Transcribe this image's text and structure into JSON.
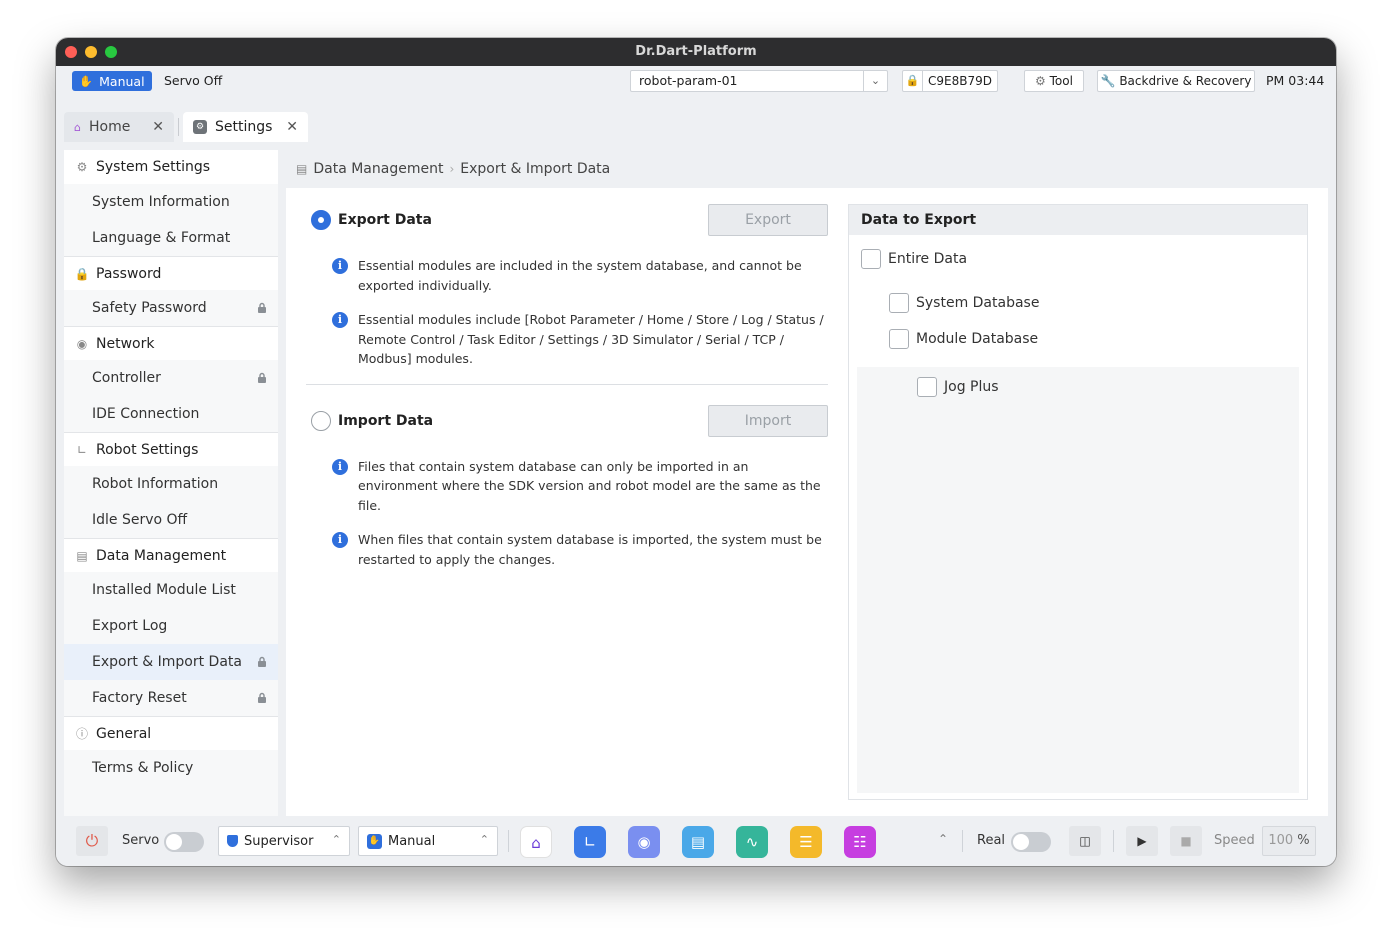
{
  "window": {
    "title": "Dr.Dart-Platform"
  },
  "topbar": {
    "mode": "Manual",
    "servo_status": "Servo Off",
    "robot_param": "robot-param-01",
    "serial": "C9E8B79D",
    "tool": "Tool",
    "backdrive": "Backdrive & Recovery",
    "clock": "PM 03:44"
  },
  "tabs": [
    {
      "label": "Home"
    },
    {
      "label": "Settings"
    }
  ],
  "sidebar": {
    "system_settings": {
      "label": "System Settings",
      "items": [
        "System Information",
        "Language & Format"
      ]
    },
    "password": {
      "label": "Password",
      "items": [
        "Safety Password"
      ]
    },
    "network": {
      "label": "Network",
      "items": [
        "Controller",
        "IDE Connection"
      ]
    },
    "robot_settings": {
      "label": "Robot Settings",
      "items": [
        "Robot Information",
        "Idle Servo Off"
      ]
    },
    "data_management": {
      "label": "Data Management",
      "items": [
        "Installed Module List",
        "Export Log",
        "Export & Import Data",
        "Factory Reset"
      ]
    },
    "general": {
      "label": "General",
      "items": [
        "Terms & Policy"
      ]
    }
  },
  "breadcrumb": {
    "parent": "Data Management",
    "current": "Export & Import Data"
  },
  "export": {
    "title": "Export Data",
    "button": "Export",
    "notes": [
      "Essential modules are included in the system database, and cannot be exported individually.",
      "Essential modules include [Robot Parameter / Home / Store / Log / Status / Remote Control / Task Editor / Settings / 3D Simulator /  Serial / TCP / Modbus] modules."
    ]
  },
  "import": {
    "title": "Import Data",
    "button": "Import",
    "notes": [
      "Files that contain system database can only be imported in an environment where the SDK version and robot model are the same as the file.",
      "When files that contain system database is imported, the system must be restarted to apply the changes."
    ]
  },
  "data_to_export": {
    "title": "Data to Export",
    "entire": "Entire Data",
    "system_db": "System Database",
    "module_db": "Module Database",
    "modules": [
      "Jog Plus"
    ]
  },
  "bottombar": {
    "servo_label": "Servo",
    "user_level": "Supervisor",
    "mode": "Manual",
    "real_label": "Real",
    "speed_label": "Speed",
    "speed_value": "100",
    "speed_unit": "%"
  },
  "colors": {
    "accent": "#2f6fdc",
    "power": "#e05a4a"
  }
}
